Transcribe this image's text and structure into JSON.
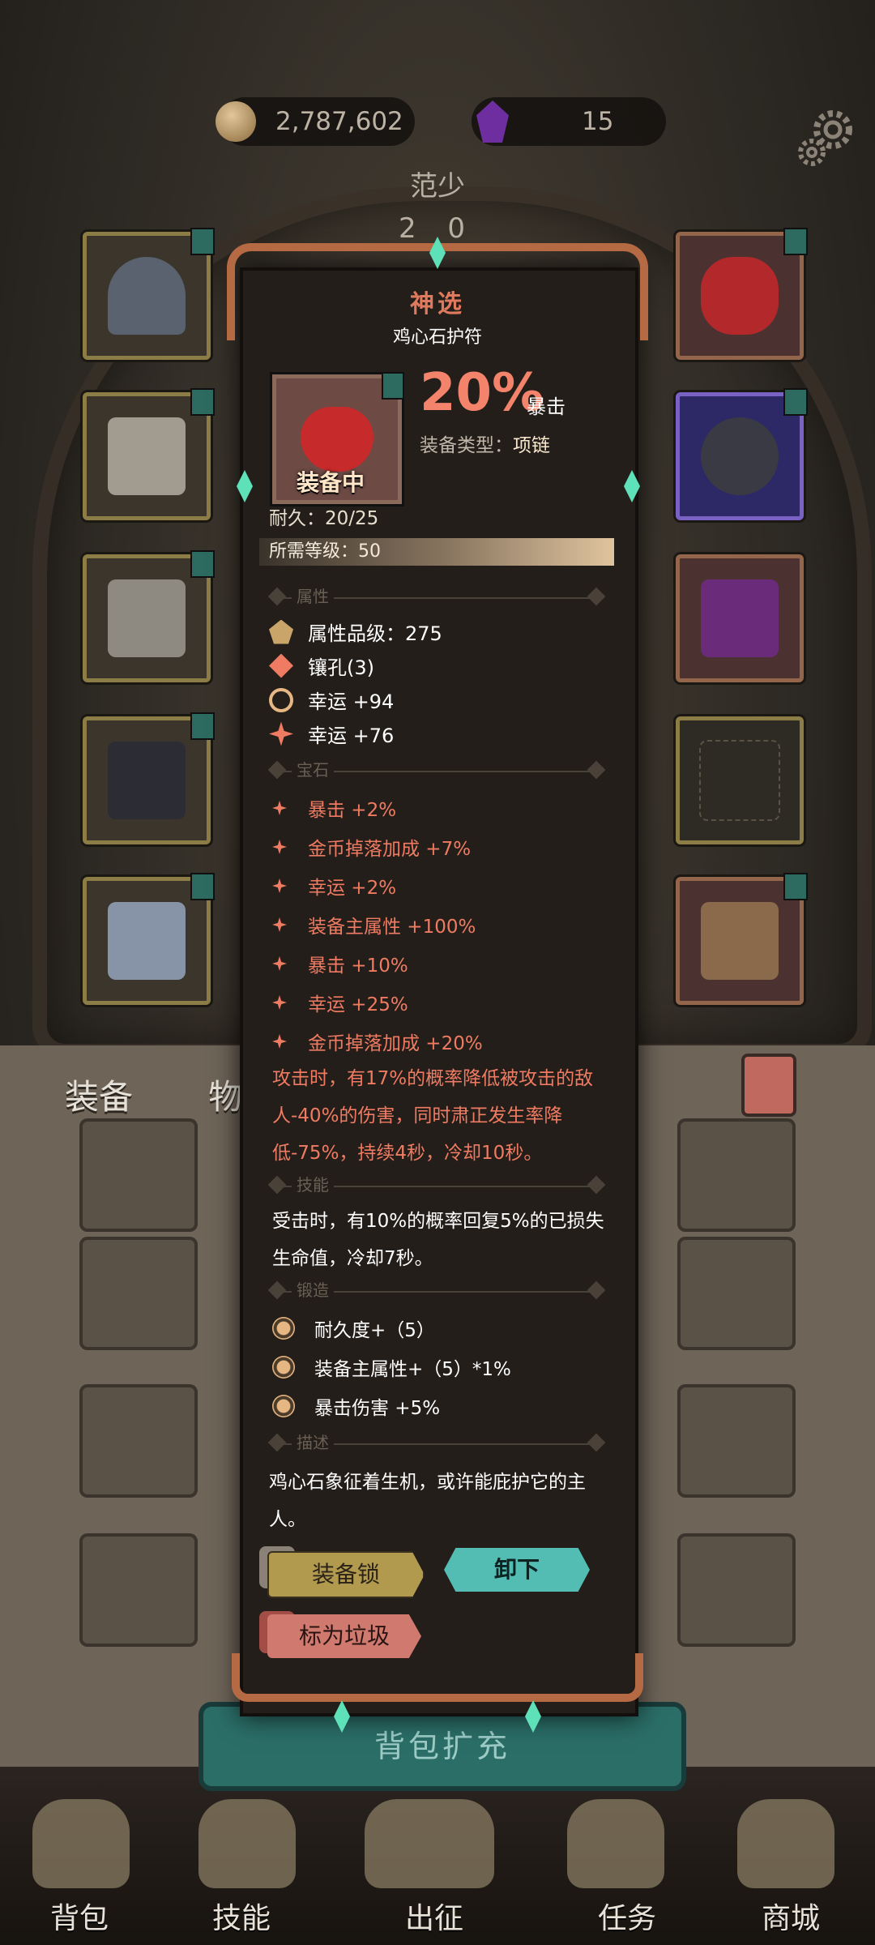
{
  "currency": {
    "gold": "2,787,602",
    "gems": "15"
  },
  "hero": {
    "name": "范少",
    "level": "2 0"
  },
  "item": {
    "rarity": "神选",
    "name": "鸡心石护符",
    "equipped_label": "装备中",
    "main_stat_value": "20%",
    "main_stat_name": "暴击",
    "type_label": "装备类型：",
    "type_value": "项链",
    "durability": "耐久：20/25",
    "required_level": "所需等级：50",
    "sections": {
      "attributes": "属性",
      "gems": "宝石",
      "skills": "技能",
      "forging": "锻造",
      "description": "描述"
    },
    "attributes": [
      "属性品级：275",
      "镶孔(3)",
      "幸运 +94",
      "幸运 +76"
    ],
    "gem_stats": [
      "暴击 +2%",
      "金币掉落加成 +7%",
      "幸运 +2%",
      "装备主属性 +100%",
      "暴击 +10%",
      "幸运 +25%",
      "金币掉落加成 +20%"
    ],
    "gem_effect": "攻击时，有17%的概率降低被攻击的敌人-40%的伤害，同时肃正发生率降低-75%，持续4秒，冷却10秒。",
    "skill_effect": "受击时，有10%的概率回复5%的已损失生命值，冷却7秒。",
    "forging": [
      "耐久度+（5）",
      "装备主属性+（5）*1%",
      "暴击伤害 +5%"
    ],
    "description": "鸡心石象征着生机，或许能庇护它的主人。"
  },
  "buttons": {
    "lock": "装备锁",
    "unequip": "卸下",
    "mark_trash": "标为垃圾",
    "expand_bag": "背包扩充"
  },
  "tabs": {
    "equipment": "装备",
    "items": "物品"
  },
  "nav": {
    "bag": "背包",
    "skills": "技能",
    "expedition": "出征",
    "quests": "任务",
    "shop": "商城"
  },
  "colors": {
    "rarity": "#e07a5f",
    "stat_highlight": "#f3836a",
    "teal_button": "#53bcb3",
    "gold_button": "#b19a4e"
  }
}
